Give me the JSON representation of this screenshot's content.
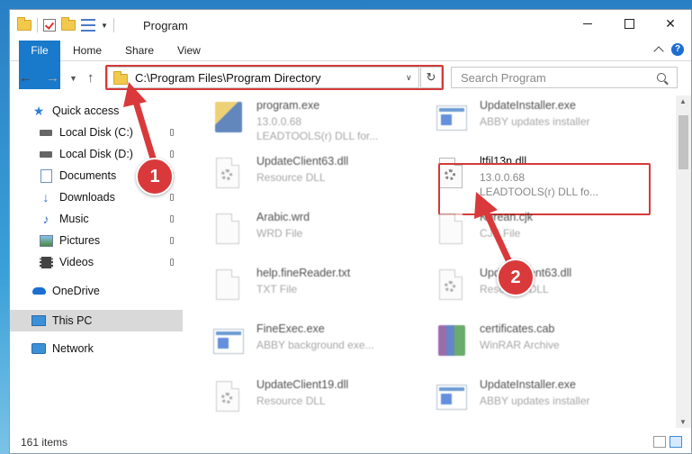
{
  "window": {
    "title": "Program"
  },
  "ribbon": {
    "tabs": [
      "File",
      "Home",
      "Share",
      "View"
    ]
  },
  "address": {
    "path": "C:\\Program Files\\Program Directory"
  },
  "search": {
    "placeholder": "Search Program"
  },
  "sidebar": {
    "items": [
      {
        "label": "Quick access",
        "icon": "star-icon"
      },
      {
        "label": "Local Disk (C:)",
        "icon": "drive-icon"
      },
      {
        "label": "Local Disk (D:)",
        "icon": "drive-icon"
      },
      {
        "label": "Documents",
        "icon": "documents-icon"
      },
      {
        "label": "Downloads",
        "icon": "download-icon"
      },
      {
        "label": "Music",
        "icon": "music-icon"
      },
      {
        "label": "Pictures",
        "icon": "pictures-icon"
      },
      {
        "label": "Videos",
        "icon": "videos-icon"
      },
      {
        "label": "OneDrive",
        "icon": "cloud-icon"
      },
      {
        "label": "This PC",
        "icon": "computer-icon"
      },
      {
        "label": "Network",
        "icon": "network-icon"
      }
    ]
  },
  "files": [
    {
      "name": "program.exe",
      "meta1": "13.0.0.68",
      "meta2": "LEADTOOLS(r) DLL for...",
      "icon": "program-icon"
    },
    {
      "name": "UpdateInstaller.exe",
      "meta1": "ABBY updates installer",
      "meta2": "",
      "icon": "exe-icon"
    },
    {
      "name": "UpdateClient63.dll",
      "meta1": "Resource DLL",
      "meta2": "",
      "icon": "dll-icon"
    },
    {
      "name": "ltfil13n.dll",
      "meta1": "13.0.0.68",
      "meta2": "LEADTOOLS(r) DLL fo...",
      "icon": "dll-icon"
    },
    {
      "name": "Arabic.wrd",
      "meta1": "WRD File",
      "meta2": "",
      "icon": "file-icon"
    },
    {
      "name": "Korean.cjk",
      "meta1": "CJK File",
      "meta2": "",
      "icon": "file-icon"
    },
    {
      "name": "help.fineReader.txt",
      "meta1": "TXT File",
      "meta2": "",
      "icon": "file-icon"
    },
    {
      "name": "UpdateClient63.dll",
      "meta1": "Resource DLL",
      "meta2": "",
      "icon": "dll-icon"
    },
    {
      "name": "FineExec.exe",
      "meta1": "ABBY background exe...",
      "meta2": "",
      "icon": "exe-icon"
    },
    {
      "name": "certificates.cab",
      "meta1": "WinRAR Archive",
      "meta2": "",
      "icon": "cab-icon"
    },
    {
      "name": "UpdateClient19.dll",
      "meta1": "Resource DLL",
      "meta2": "",
      "icon": "dll-icon"
    },
    {
      "name": "UpdateInstaller.exe",
      "meta1": "ABBY updates installer",
      "meta2": "",
      "icon": "exe-icon"
    }
  ],
  "status": {
    "item_count": "161 items"
  },
  "callouts": {
    "one": "1",
    "two": "2"
  },
  "colors": {
    "accent": "#1979ca",
    "highlight": "#d33a3a"
  }
}
